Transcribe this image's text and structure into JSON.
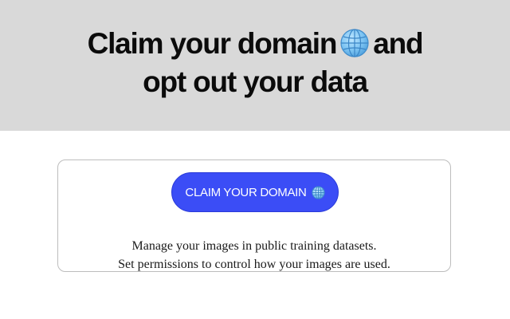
{
  "hero": {
    "title_line1_before_icon": "Claim your domain",
    "title_line1_after_icon": "and",
    "title_line2": "opt out your data",
    "background": "#d9d9d9",
    "icon": "globe-icon"
  },
  "card": {
    "button_label": "CLAIM YOUR DOMAIN",
    "button_icon": "globe-icon",
    "button_color": "#3b4df6",
    "description_line1": "Manage your images in public training datasets.",
    "description_line2": "Set permissions to control how your images are used."
  }
}
